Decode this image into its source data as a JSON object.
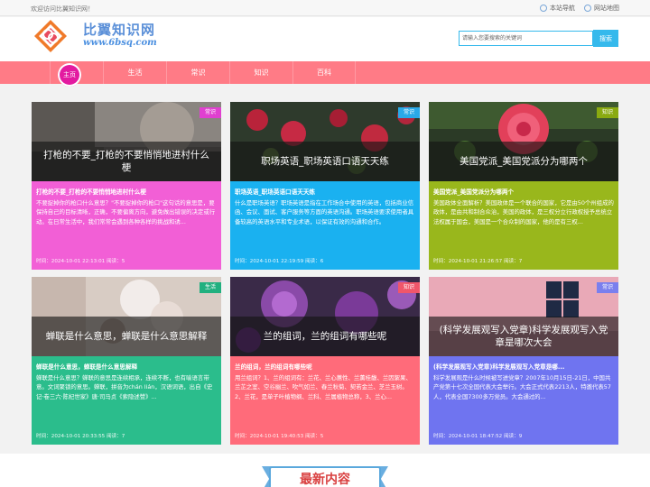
{
  "topbar": {
    "welcome": "欢迎访问比翼知识网！",
    "links": [
      {
        "label": "本站导航"
      },
      {
        "label": "网站地图"
      }
    ]
  },
  "header": {
    "site_name": "比翼知识网",
    "site_url": "www.6bsq.com"
  },
  "search": {
    "placeholder": "请输入您要搜索的关键词",
    "button": "搜索"
  },
  "nav": {
    "items": [
      {
        "label": "主页"
      },
      {
        "label": "生活"
      },
      {
        "label": "常识"
      },
      {
        "label": "知识"
      },
      {
        "label": "百科"
      }
    ]
  },
  "cards": [
    {
      "caption": "打枪的不要_打枪的不要悄悄地进村什么梗",
      "tag": "常识",
      "title": "打枪的不要_打枪的不要悄悄地进村什么梗",
      "desc": "不要捉掉你的枪口什么意思？\"不要捉掉你的枪口\"这句话的意思是，要保持自己的目标清晰，正确，不要偏离方向，避免做出错误的决定或行动。在日常生活中，我们常常会遇到各种各样的挑战和诱...",
      "meta": "时间：2024-10-01 22:13:01 阅读：5",
      "color": "#f25fd6",
      "tagcolor": "#e040d0"
    },
    {
      "caption": "职场英语_职场英语口语天天练",
      "tag": "常识",
      "title": "职场英语_职场英语口语天天练",
      "desc": "什么是职场英语？职场英语是指在工作场合中使用的英语，包括商业信函、会议、面试、客户服务等方面的英语沟通。职场英语要求使用者具备较高的英语水平和专业术语，以保证有效的沟通和合作。",
      "meta": "时间：2024-10-01 22:19:59 阅读：6",
      "color": "#1ab1f0",
      "tagcolor": "#2aa9e8"
    },
    {
      "caption": "美国党派_美国党派分为哪两个",
      "tag": "知识",
      "title": "美国党派_美国党派分为哪两个",
      "desc": "美国政体全面解析？美国政体是一个联合的国家，它是由50个州组成的政体，是由共和制合众治，美国的政体，是三权分立行政权授予总统立法权属于国会，美国是一个合众制的国家，他的是有三权...",
      "meta": "时间：2024-10-01 21:26:57 阅读：7",
      "color": "#99b71c",
      "tagcolor": "#8aaa10"
    },
    {
      "caption": "蝉联是什么意思，蝉联是什么意思解释",
      "tag": "生活",
      "title": "蝉联是什么意思，蝉联是什么意思解释",
      "desc": "蝉联是什么意思？蝉联的意思是连续相承，连续不断，也有喻语言带意。文词聚锁的意思。蝉联，拼音为chán lián，汉语词语，出自《史记·卷三六·陈杞世家》唐·司马贞《索隐述赞》...",
      "meta": "时间：2024-10-01 20:33:55 阅读：7",
      "color": "#2bbd8c",
      "tagcolor": "#21b07f"
    },
    {
      "caption": "兰的组词，兰的组词有哪些呢",
      "tag": "知识",
      "title": "兰的组词，兰的组词有哪些呢",
      "desc": "用兰组词？1、兰的组词有：兰花、兰心蕙性、兰薰桂馥、兰因絮果、兰芷之室、空谷幽兰、吹气如兰、春兰秋菊、契若金兰、芝兰玉树。2、兰花，是单子叶植物纲、兰科、兰属植物总称，3、兰心...",
      "meta": "时间：2024-10-01 19:40:53 阅读：5",
      "color": "#ff6b7a",
      "tagcolor": "#f0566a"
    },
    {
      "caption": "(科学发展观写入党章)科学发展观写入党章是哪次大会",
      "tag": "常识",
      "title": "(科学发展观写入党章)科学发展观写入党章是哪...",
      "desc": "科学发展观是什么时候被写进党章？2007年10月15日-21日，中国共产党第十七次全国代表大会举行。大会正式代表2213人，特邀代表57人，代表全国7300多万党员。大会通过的...",
      "meta": "时间：2024-10-01 18:47:52 阅读：9",
      "color": "#6f74f0",
      "tagcolor": "#7a7fee"
    }
  ],
  "section": {
    "title": "最新内容"
  }
}
